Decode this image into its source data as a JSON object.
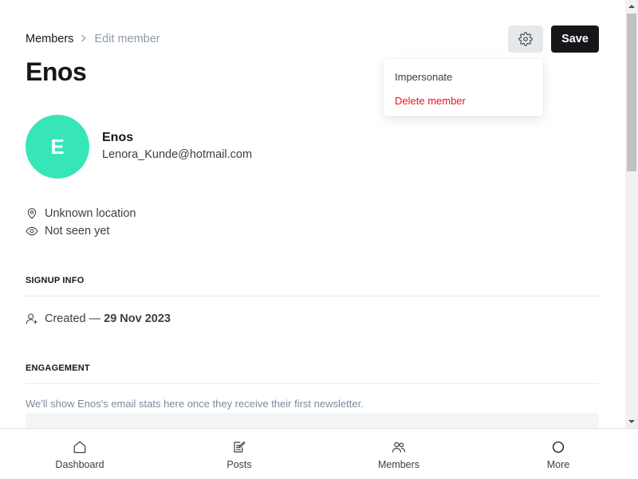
{
  "breadcrumb": {
    "parent": "Members",
    "separator": ">",
    "current": "Edit member"
  },
  "page_title": "Enos",
  "header_actions": {
    "settings_icon": "gear-icon",
    "save_label": "Save"
  },
  "dropdown": {
    "items": [
      {
        "label": "Impersonate"
      },
      {
        "label": "Delete member",
        "color": "#f50b23"
      }
    ]
  },
  "member": {
    "avatar_initial": "E",
    "avatar_color": "#37e6b8",
    "name": "Enos",
    "email": "Lenora_Kunde@hotmail.com",
    "location": "Unknown location",
    "last_seen": "Not seen yet"
  },
  "signup_info": {
    "heading": "SIGNUP INFO",
    "created_label": "Created —",
    "created_date": "29 Nov 2023"
  },
  "engagement": {
    "heading": "ENGAGEMENT",
    "empty_text": "We'll show Enos's email stats here once they receive their first newsletter."
  },
  "bottom_nav": {
    "items": [
      {
        "label": "Dashboard",
        "icon": "home-icon"
      },
      {
        "label": "Posts",
        "icon": "posts-icon"
      },
      {
        "label": "Members",
        "icon": "members-icon"
      },
      {
        "label": "More",
        "icon": "more-circle-icon"
      }
    ]
  }
}
